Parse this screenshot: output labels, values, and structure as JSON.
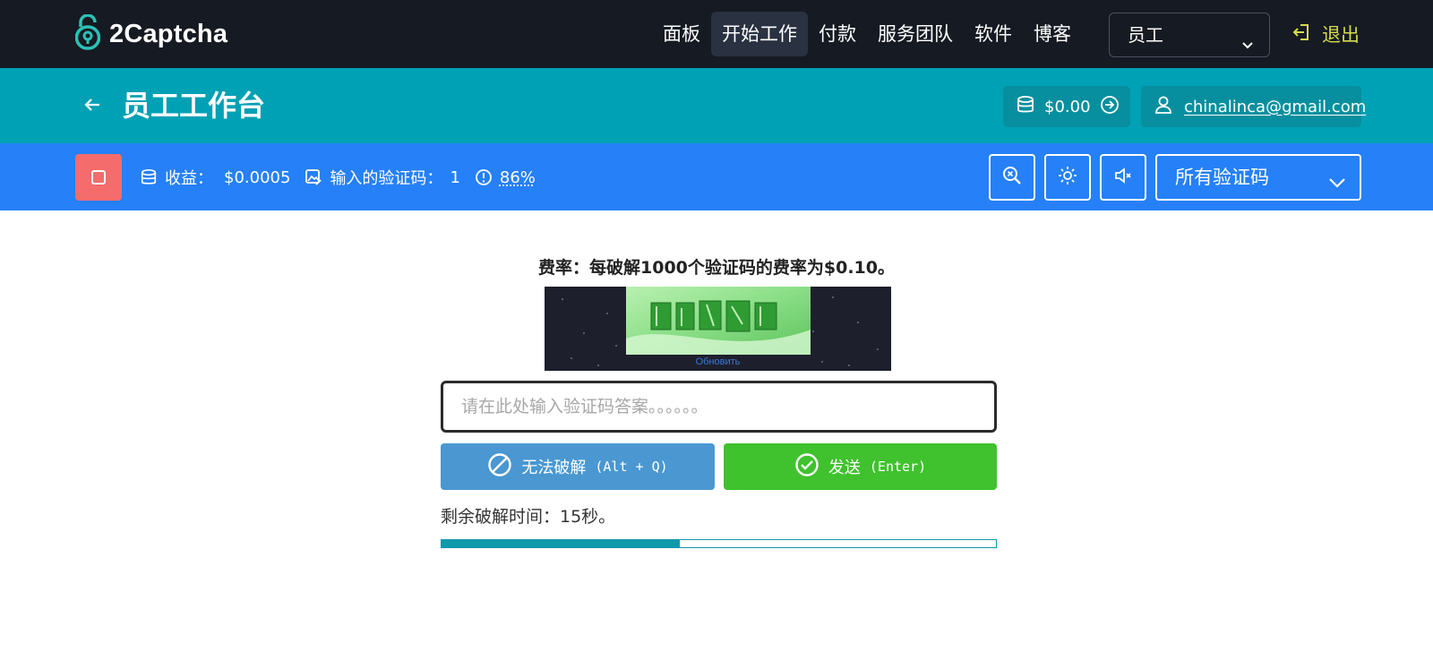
{
  "brand": {
    "name": "2Captcha"
  },
  "nav": {
    "items": [
      "面板",
      "开始工作",
      "付款",
      "服务团队",
      "软件",
      "博客"
    ],
    "active_index": 1,
    "role_select": "员工",
    "logout": "退出"
  },
  "header": {
    "title": "员工工作台",
    "balance": "$0.00",
    "email": "chinalinca@gmail.com"
  },
  "toolbar": {
    "earnings_label": "收益：",
    "earnings_value": "$0.0005",
    "entered_label": "输入的验证码：",
    "entered_value": "1",
    "accuracy": "86%",
    "filter": "所有验证码"
  },
  "main": {
    "rate_text": "费率：每破解1000个验证码的费率为$0.10。",
    "captcha_caption": "Обновить",
    "answer_placeholder": "请在此处输入验证码答案。。。。。。",
    "answer_value": "",
    "cant_solve_label": "无法破解",
    "cant_solve_key": "(Alt + Q)",
    "send_label": "发送",
    "send_key": "(Enter)",
    "timer_text": "剩余破解时间：15秒。",
    "progress_fraction": 0.43
  },
  "colors": {
    "topbar": "#161a22",
    "header": "#00a1b4",
    "toolbar": "#2680f7",
    "stop": "#f46c6c",
    "cant_solve": "#4a97d1",
    "send": "#3fc22d",
    "logout": "#d4dc4c"
  }
}
